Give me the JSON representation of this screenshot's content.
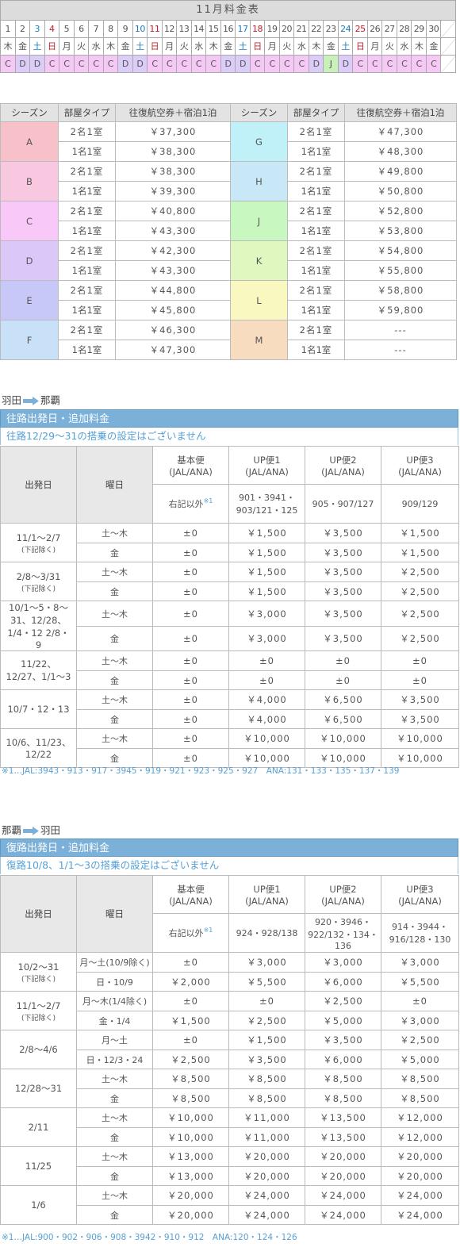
{
  "calendar": {
    "title": "11月料金表",
    "days": [
      "1",
      "2",
      "3",
      "4",
      "5",
      "6",
      "7",
      "8",
      "9",
      "10",
      "11",
      "12",
      "13",
      "14",
      "15",
      "16",
      "17",
      "18",
      "19",
      "20",
      "21",
      "22",
      "23",
      "24",
      "25",
      "26",
      "27",
      "28",
      "29",
      "30"
    ],
    "weekdays": [
      "木",
      "金",
      "土",
      "日",
      "月",
      "火",
      "水",
      "木",
      "金",
      "土",
      "日",
      "月",
      "火",
      "水",
      "木",
      "金",
      "土",
      "日",
      "月",
      "火",
      "水",
      "木",
      "金",
      "土",
      "日",
      "月",
      "火",
      "水",
      "木",
      "金"
    ],
    "seasons": [
      "C",
      "D",
      "D",
      "C",
      "C",
      "C",
      "C",
      "C",
      "D",
      "D",
      "C",
      "C",
      "C",
      "C",
      "C",
      "D",
      "D",
      "C",
      "C",
      "C",
      "C",
      "D",
      "J",
      "D",
      "C",
      "C",
      "C",
      "C",
      "C",
      "C"
    ],
    "colors": {
      "C": "#f6c8f5",
      "D": "#dcccf8",
      "J": "#c8f0b8"
    }
  },
  "season_table": {
    "headers": [
      "シーズン",
      "部屋タイプ",
      "往復航空券＋宿泊1泊",
      "シーズン",
      "部屋タイプ",
      "往復航空券＋宿泊1泊"
    ],
    "rows": [
      {
        "left": {
          "season": "A",
          "color": "#f8c0c8",
          "r1": "2名1室",
          "p1": "￥37,300",
          "r2": "1名1室",
          "p2": "￥38,300"
        },
        "right": {
          "season": "G",
          "color": "#c0f0f8",
          "r1": "2名1室",
          "p1": "￥47,300",
          "r2": "1名1室",
          "p2": "￥48,300"
        }
      },
      {
        "left": {
          "season": "B",
          "color": "#f8c8e0",
          "r1": "2名1室",
          "p1": "￥38,300",
          "r2": "1名1室",
          "p2": "￥39,300"
        },
        "right": {
          "season": "H",
          "color": "#c8e8f8",
          "r1": "2名1室",
          "p1": "￥49,800",
          "r2": "1名1室",
          "p2": "￥50,800"
        }
      },
      {
        "left": {
          "season": "C",
          "color": "#f8c8f8",
          "r1": "2名1室",
          "p1": "￥40,800",
          "r2": "1名1室",
          "p2": "￥43,300"
        },
        "right": {
          "season": "J",
          "color": "#c8f8c0",
          "r1": "2名1室",
          "p1": "￥52,800",
          "r2": "1名1室",
          "p2": "￥53,800"
        }
      },
      {
        "left": {
          "season": "D",
          "color": "#dcc8f8",
          "r1": "2名1室",
          "p1": "￥42,300",
          "r2": "1名1室",
          "p2": "￥43,300"
        },
        "right": {
          "season": "K",
          "color": "#e0f8c0",
          "r1": "2名1室",
          "p1": "￥54,800",
          "r2": "1名1室",
          "p2": "￥55,800"
        }
      },
      {
        "left": {
          "season": "E",
          "color": "#c8c8f8",
          "r1": "2名1室",
          "p1": "￥44,800",
          "r2": "1名1室",
          "p2": "￥45,800"
        },
        "right": {
          "season": "L",
          "color": "#f8f8c0",
          "r1": "2名1室",
          "p1": "￥58,800",
          "r2": "1名1室",
          "p2": "￥59,800"
        }
      },
      {
        "left": {
          "season": "F",
          "color": "#c8e0f8",
          "r1": "2名1室",
          "p1": "￥46,300",
          "r2": "1名1室",
          "p2": "￥47,300"
        },
        "right": {
          "season": "M",
          "color": "#f8dcc0",
          "r1": "2名1室",
          "p1": "---",
          "r2": "1名1室",
          "p2": "---"
        }
      }
    ]
  },
  "outbound": {
    "route_from": "羽田",
    "route_to": "那覇",
    "bar": "往路出発日・追加料金",
    "note": "往路12/29～31の搭乗の設定はございません",
    "h_date": "出発日",
    "h_day": "曜日",
    "cols": [
      {
        "top": "基本便",
        "sub": "(JAL/ANA)",
        "flights": "右記以外"
      },
      {
        "top": "UP便1",
        "sub": "(JAL/ANA)",
        "flights": "901・3941・903/121・125"
      },
      {
        "top": "UP便2",
        "sub": "(JAL/ANA)",
        "flights": "905・907/127"
      },
      {
        "top": "UP便3",
        "sub": "(JAL/ANA)",
        "flights": "909/129"
      }
    ],
    "mark": "※1",
    "rows": [
      {
        "date": "11/1～2/7",
        "dnote": "(下記除く)",
        "d1": "土～木",
        "v1": [
          "±0",
          "￥1,500",
          "￥3,500",
          "￥1,500"
        ],
        "d2": "金",
        "v2": [
          "±0",
          "￥1,500",
          "￥3,500",
          "￥1,500"
        ]
      },
      {
        "date": "2/8～3/31",
        "dnote": "(下記除く)",
        "d1": "土～木",
        "v1": [
          "±0",
          "￥1,500",
          "￥3,500",
          "￥2,500"
        ],
        "d2": "金",
        "v2": [
          "±0",
          "￥1,500",
          "￥3,500",
          "￥2,500"
        ]
      },
      {
        "date": "10/1～5・8～31、12/28、1/4・12 2/8・9",
        "dnote": "",
        "d1": "土～木",
        "v1": [
          "±0",
          "￥3,000",
          "￥3,500",
          "￥2,500"
        ],
        "d2": "金",
        "v2": [
          "±0",
          "￥3,000",
          "￥3,500",
          "￥2,500"
        ]
      },
      {
        "date": "11/22、12/27、1/1～3",
        "dnote": "",
        "d1": "土～木",
        "v1": [
          "±0",
          "±0",
          "±0",
          "±0"
        ],
        "d2": "金",
        "v2": [
          "±0",
          "±0",
          "±0",
          "±0"
        ]
      },
      {
        "date": "10/7・12・13",
        "dnote": "",
        "d1": "土～木",
        "v1": [
          "±0",
          "￥4,000",
          "￥6,500",
          "￥3,500"
        ],
        "d2": "金",
        "v2": [
          "±0",
          "￥4,000",
          "￥6,500",
          "￥3,500"
        ]
      },
      {
        "date": "10/6、11/23、12/22",
        "dnote": "",
        "d1": "土～木",
        "v1": [
          "±0",
          "￥10,000",
          "￥10,000",
          "￥10,000"
        ],
        "d2": "金",
        "v2": [
          "±0",
          "￥10,000",
          "￥10,000",
          "￥10,000"
        ]
      }
    ],
    "footnote": "※1…JAL:3943・913・917・3945・919・921・923・925・927　ANA:131・133・135・137・139"
  },
  "inbound": {
    "route_from": "那覇",
    "route_to": "羽田",
    "bar": "復路出発日・追加料金",
    "note": "復路10/8、1/1～3の搭乗の設定はございません",
    "h_date": "出発日",
    "h_day": "曜日",
    "cols": [
      {
        "top": "基本便",
        "sub": "(JAL/ANA)",
        "flights": "右記以外"
      },
      {
        "top": "UP便1",
        "sub": "(JAL/ANA)",
        "flights": "924・928/138"
      },
      {
        "top": "UP便2",
        "sub": "(JAL/ANA)",
        "flights": "920・3946・922/132・134・136"
      },
      {
        "top": "UP便3",
        "sub": "(JAL/ANA)",
        "flights": "914・3944・916/128・130"
      }
    ],
    "mark": "※1",
    "rows": [
      {
        "date": "10/2～31",
        "dnote": "(下記除く)",
        "d1": "月～土(10/9除く)",
        "v1": [
          "±0",
          "￥3,000",
          "￥3,000",
          "￥3,000"
        ],
        "d2": "日・10/9",
        "v2": [
          "￥2,000",
          "￥5,500",
          "￥6,000",
          "￥5,500"
        ]
      },
      {
        "date": "11/1～2/7",
        "dnote": "(下記除く)",
        "d1": "月～木(1/4除く)",
        "v1": [
          "±0",
          "±0",
          "￥2,500",
          "±0"
        ],
        "d2": "金・1/4",
        "v2": [
          "￥1,500",
          "￥2,500",
          "￥5,000",
          "￥3,000"
        ]
      },
      {
        "date": "2/8～4/6",
        "dnote": "",
        "d1": "月～土",
        "v1": [
          "±0",
          "￥1,500",
          "￥3,500",
          "￥2,500"
        ],
        "d2": "日・12/3・24",
        "v2": [
          "￥2,500",
          "￥3,500",
          "￥6,000",
          "￥5,000"
        ]
      },
      {
        "date": "12/28～31",
        "dnote": "",
        "d1": "土～木",
        "v1": [
          "￥8,500",
          "￥8,500",
          "￥8,500",
          "￥8,500"
        ],
        "d2": "金",
        "v2": [
          "￥8,500",
          "￥8,500",
          "￥8,500",
          "￥8,500"
        ]
      },
      {
        "date": "2/11",
        "dnote": "",
        "d1": "土～木",
        "v1": [
          "￥10,000",
          "￥11,000",
          "￥13,500",
          "￥12,000"
        ],
        "d2": "金",
        "v2": [
          "￥10,000",
          "￥11,000",
          "￥13,500",
          "￥12,000"
        ]
      },
      {
        "date": "11/25",
        "dnote": "",
        "d1": "土～木",
        "v1": [
          "￥13,000",
          "￥20,000",
          "￥20,000",
          "￥20,000"
        ],
        "d2": "金",
        "v2": [
          "￥13,000",
          "￥20,000",
          "￥20,000",
          "￥20,000"
        ]
      },
      {
        "date": "1/6",
        "dnote": "",
        "d1": "土～木",
        "v1": [
          "￥20,000",
          "￥24,000",
          "￥24,000",
          "￥24,000"
        ],
        "d2": "金",
        "v2": [
          "￥20,000",
          "￥24,000",
          "￥24,000",
          "￥24,000"
        ]
      }
    ],
    "footnote": "※1…JAL:900・902・906・908・3942・910・912　ANA:120・124・126"
  }
}
